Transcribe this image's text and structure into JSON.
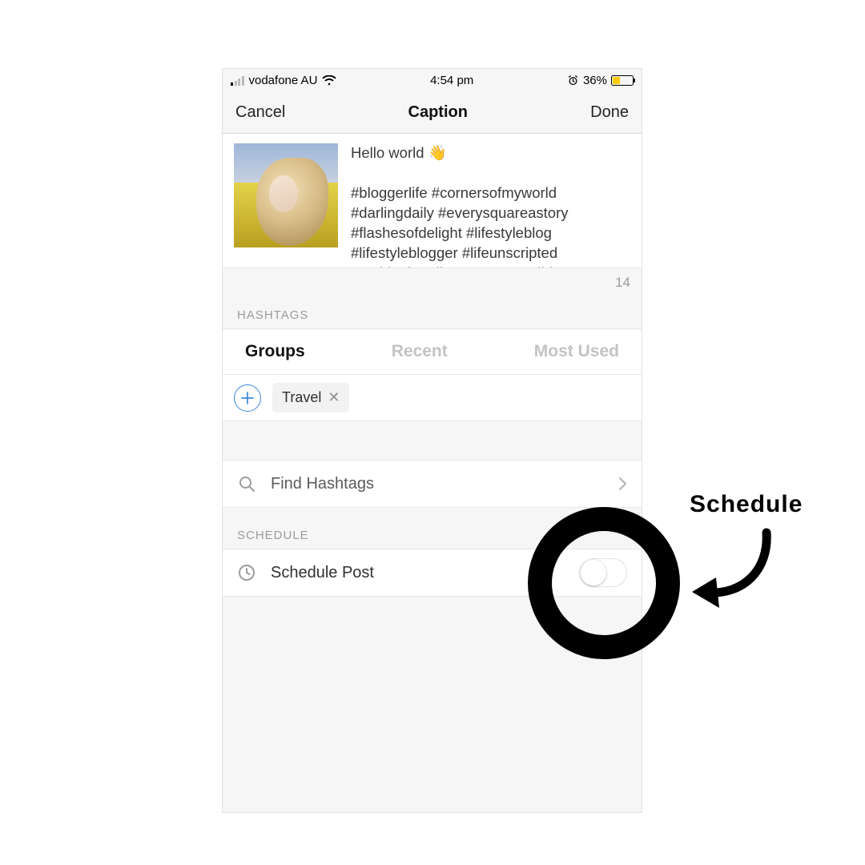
{
  "statusbar": {
    "carrier": "vodafone AU",
    "time": "4:54 pm",
    "battery_pct": "36%"
  },
  "navbar": {
    "cancel": "Cancel",
    "title": "Caption",
    "done": "Done"
  },
  "caption": {
    "text": "Hello world 👋\n\n#bloggerlife #cornersofmyworld #darlingdaily #everysquareastory #flashesofdelight #lifestyleblog #lifestyleblogger #lifeunscripted #nothingisordinary #personalblog"
  },
  "counter": "14",
  "sections": {
    "hashtags_label": "HASHTAGS",
    "schedule_label": "SCHEDULE"
  },
  "tabs": {
    "groups": "Groups",
    "recent": "Recent",
    "most_used": "Most Used"
  },
  "chips": {
    "travel": "Travel"
  },
  "find_hashtags": "Find Hashtags",
  "schedule_post": "Schedule Post",
  "annotation": {
    "label": "Schedule"
  }
}
